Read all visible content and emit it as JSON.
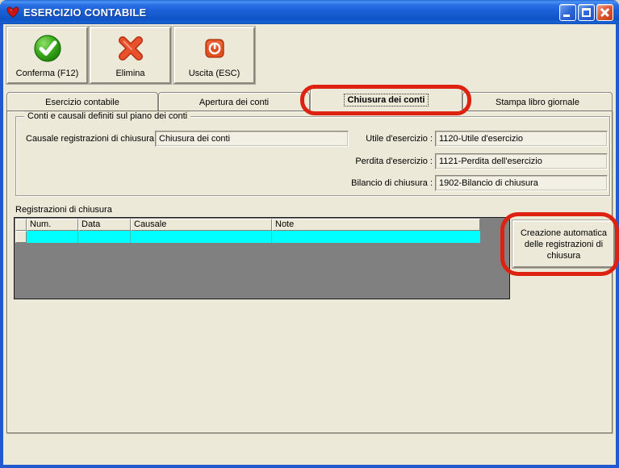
{
  "window": {
    "title": "ESERCIZIO CONTABILE",
    "icon": "strawberry-app-icon"
  },
  "toolbar": {
    "buttons": [
      {
        "label": "Conferma (F12)",
        "icon": "confirm-check-icon"
      },
      {
        "label": "Elimina",
        "icon": "delete-x-icon"
      },
      {
        "label": "Uscita (ESC)",
        "icon": "exit-power-icon"
      }
    ]
  },
  "tabs": [
    {
      "label": "Esercizio contabile",
      "active": false
    },
    {
      "label": "Apertura dei conti",
      "active": false
    },
    {
      "label": "Chiusura dei conti",
      "active": true,
      "annotated": true
    },
    {
      "label": "Stampa libro giornale",
      "active": false
    }
  ],
  "groupbox": {
    "title": "Conti e causali definiti sul piano dei conti",
    "fields": {
      "causale": {
        "label": "Causale registrazioni di chiusura :",
        "value": "Chiusura dei conti"
      },
      "utile": {
        "label": "Utile d'esercizio :",
        "value": "1120-Utile d'esercizio"
      },
      "perdita": {
        "label": "Perdita d'esercizio :",
        "value": "1121-Perdita dell'esercizio"
      },
      "bilancio": {
        "label": "Bilancio di chiusura :",
        "value": "1902-Bilancio di chiusura"
      }
    }
  },
  "registrations": {
    "title": "Registrazioni di chiusura",
    "columns": [
      "Num.",
      "Data",
      "Causale",
      "Note"
    ],
    "rows": [
      {
        "num": "",
        "data": "",
        "causale": "",
        "note": ""
      }
    ],
    "selected_row_index": 0
  },
  "actions": {
    "create_button_label": "Creazione automatica delle registrazioni di chiusura"
  },
  "colors": {
    "titlebar_blue": "#1b60d6",
    "client_bg": "#ece9d8",
    "selected_row_cyan": "#00ffff",
    "grid_empty_gray": "#808080",
    "annotation_red": "#dd2211",
    "confirm_green": "#2f9e14",
    "delete_red": "#e2472b",
    "exit_orange": "#e25022"
  }
}
